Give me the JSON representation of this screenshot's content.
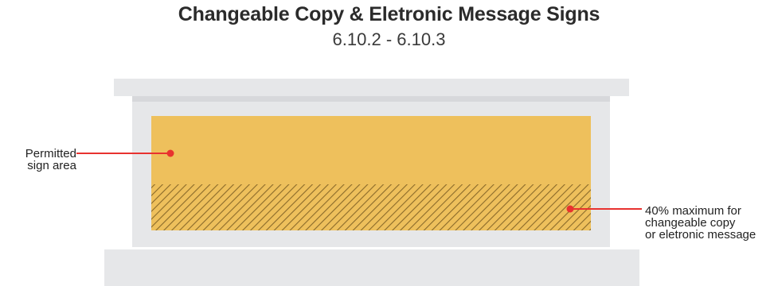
{
  "title": "Changeable Copy & Eletronic Message Signs",
  "subtitle": "6.10.2 - 6.10.3",
  "callouts": {
    "permitted": {
      "lines": [
        "Permitted",
        "sign area"
      ]
    },
    "maximum": {
      "lines": [
        "40% maximum for",
        "changeable copy",
        "or eletronic message"
      ],
      "value": 0.4
    }
  },
  "colors": {
    "frame": "#e6e7e9",
    "frame_shadow": "#d7d8db",
    "sign": "#eec05c",
    "hatch": "#8a6a2a",
    "callout_line": "#e8322f"
  }
}
